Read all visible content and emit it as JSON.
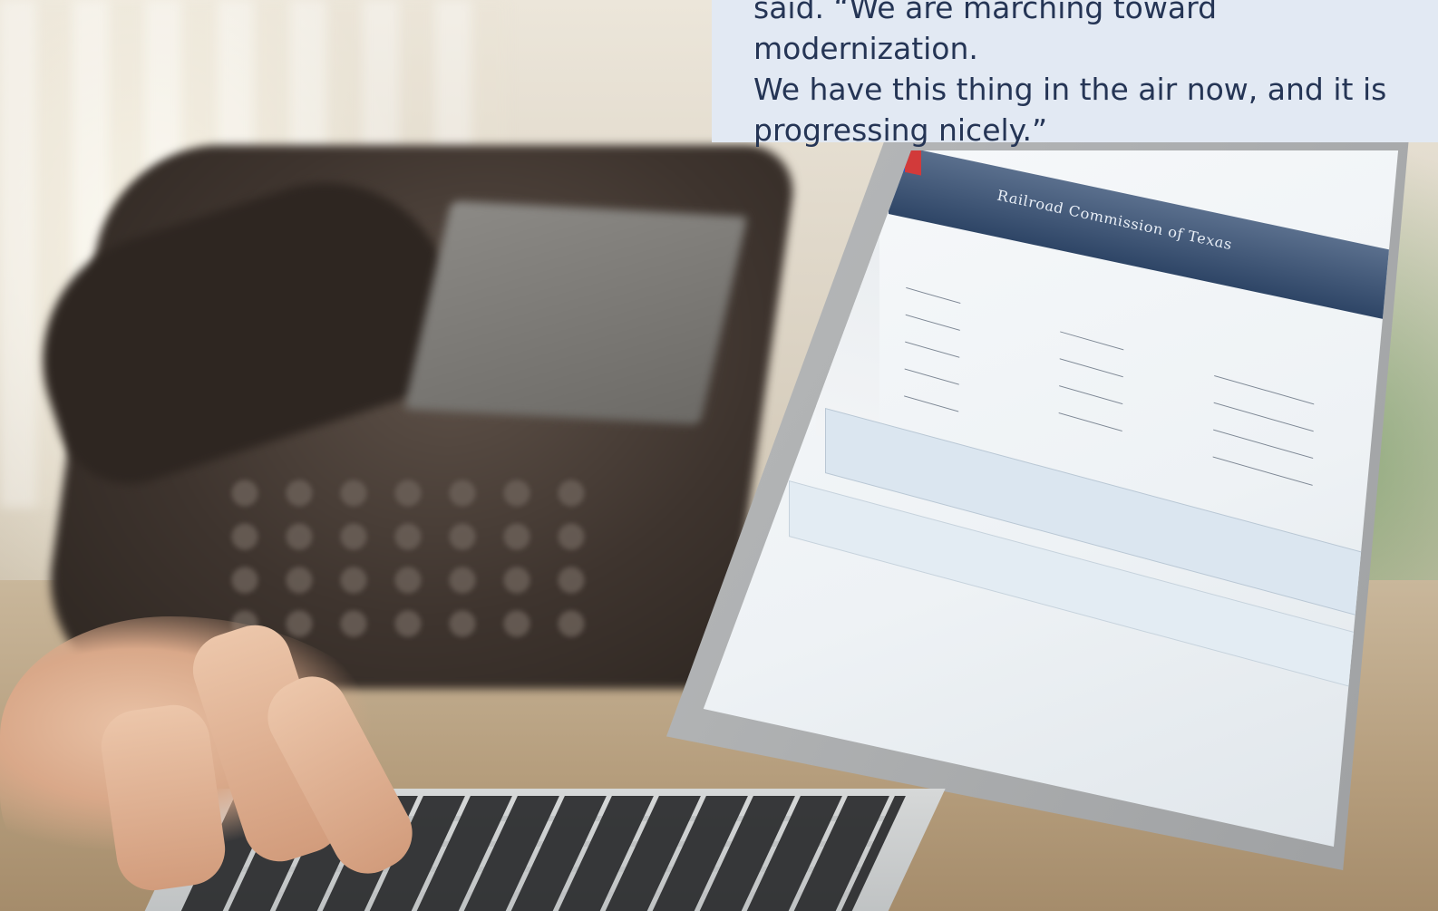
{
  "quote": {
    "lines": [
      "said. “We are marching toward modernization.",
      "We have this thing in the air now, and it is",
      "progressing nicely.”"
    ]
  },
  "laptop_app": {
    "title": "Railroad Commission of Texas"
  },
  "colors": {
    "quote_background": "#e2e9f3",
    "quote_text": "#253555",
    "app_header": "#2e4566"
  }
}
